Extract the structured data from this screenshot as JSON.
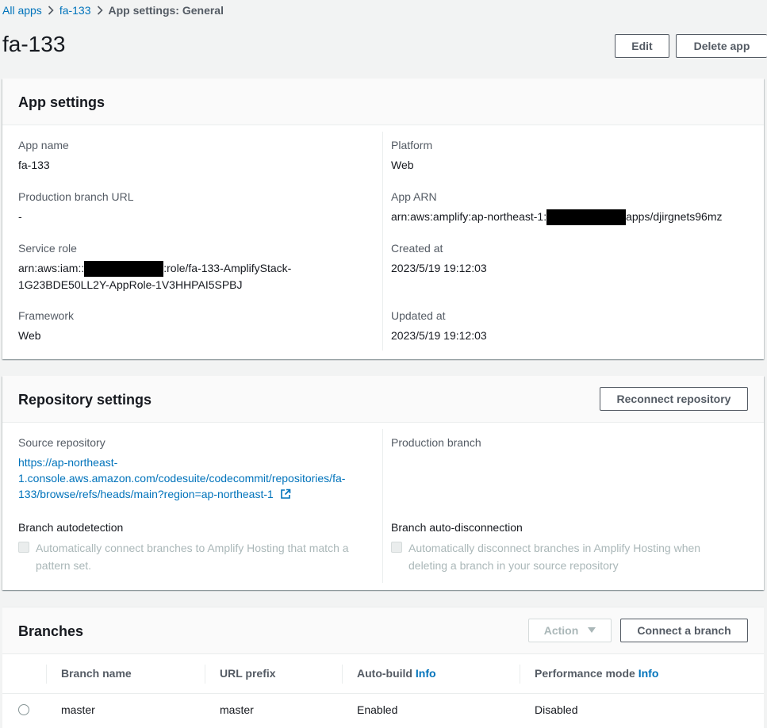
{
  "breadcrumb": {
    "items": [
      "All apps",
      "fa-133",
      "App settings: General"
    ]
  },
  "page": {
    "title": "fa-133",
    "edit_label": "Edit",
    "delete_label": "Delete app"
  },
  "app_settings": {
    "title": "App settings",
    "app_name": {
      "label": "App name",
      "value": "fa-133"
    },
    "prod_branch_url": {
      "label": "Production branch URL",
      "value": "-"
    },
    "service_role": {
      "label": "Service role",
      "value_prefix": "arn:aws:iam::",
      "value_suffix": ":role/fa-133-AmplifyStack-",
      "value_line2": "1G23BDE50LL2Y-AppRole-1V3HHPAI5SPBJ"
    },
    "framework": {
      "label": "Framework",
      "value": "Web"
    },
    "platform": {
      "label": "Platform",
      "value": "Web"
    },
    "app_arn": {
      "label": "App ARN",
      "value_prefix": "arn:aws:amplify:ap-northeast-1:",
      "value_suffix": "apps/djirgnets96mz"
    },
    "created_at": {
      "label": "Created at",
      "value": "2023/5/19 19:12:03"
    },
    "updated_at": {
      "label": "Updated at",
      "value": "2023/5/19 19:12:03"
    }
  },
  "repository_settings": {
    "title": "Repository settings",
    "reconnect_label": "Reconnect repository",
    "source_repo": {
      "label": "Source repository",
      "line1": "https://ap-northeast-",
      "line2": "1.console.aws.amazon.com/codesuite/codecommit/repositories/fa-",
      "line3": "133/browse/refs/heads/main?region=ap-northeast-1"
    },
    "production_branch": {
      "label": "Production branch"
    },
    "branch_autodetection": {
      "label": "Branch autodetection",
      "checkbox_line1": "Automatically connect branches to Amplify Hosting that match a",
      "checkbox_line2": "pattern set."
    },
    "branch_autodisconnection": {
      "label": "Branch auto-disconnection",
      "checkbox_line1": "Automatically disconnect branches in Amplify Hosting when",
      "checkbox_line2": "deleting a branch in your source repository"
    },
    "external_link_icon": "external-link-icon"
  },
  "branches": {
    "title": "Branches",
    "action_label": "Action",
    "connect_label": "Connect a branch",
    "columns": [
      "Branch name",
      "URL prefix",
      "Auto-build",
      "Performance mode"
    ],
    "info_label": "Info",
    "rows": [
      {
        "branch_name": "master",
        "url_prefix": "master",
        "auto_build": "Enabled",
        "performance_mode": "Disabled"
      }
    ]
  },
  "colors": {
    "link": "#0073bb",
    "background": "#f2f3f3",
    "text": "#16191f",
    "muted": "#545b64"
  }
}
